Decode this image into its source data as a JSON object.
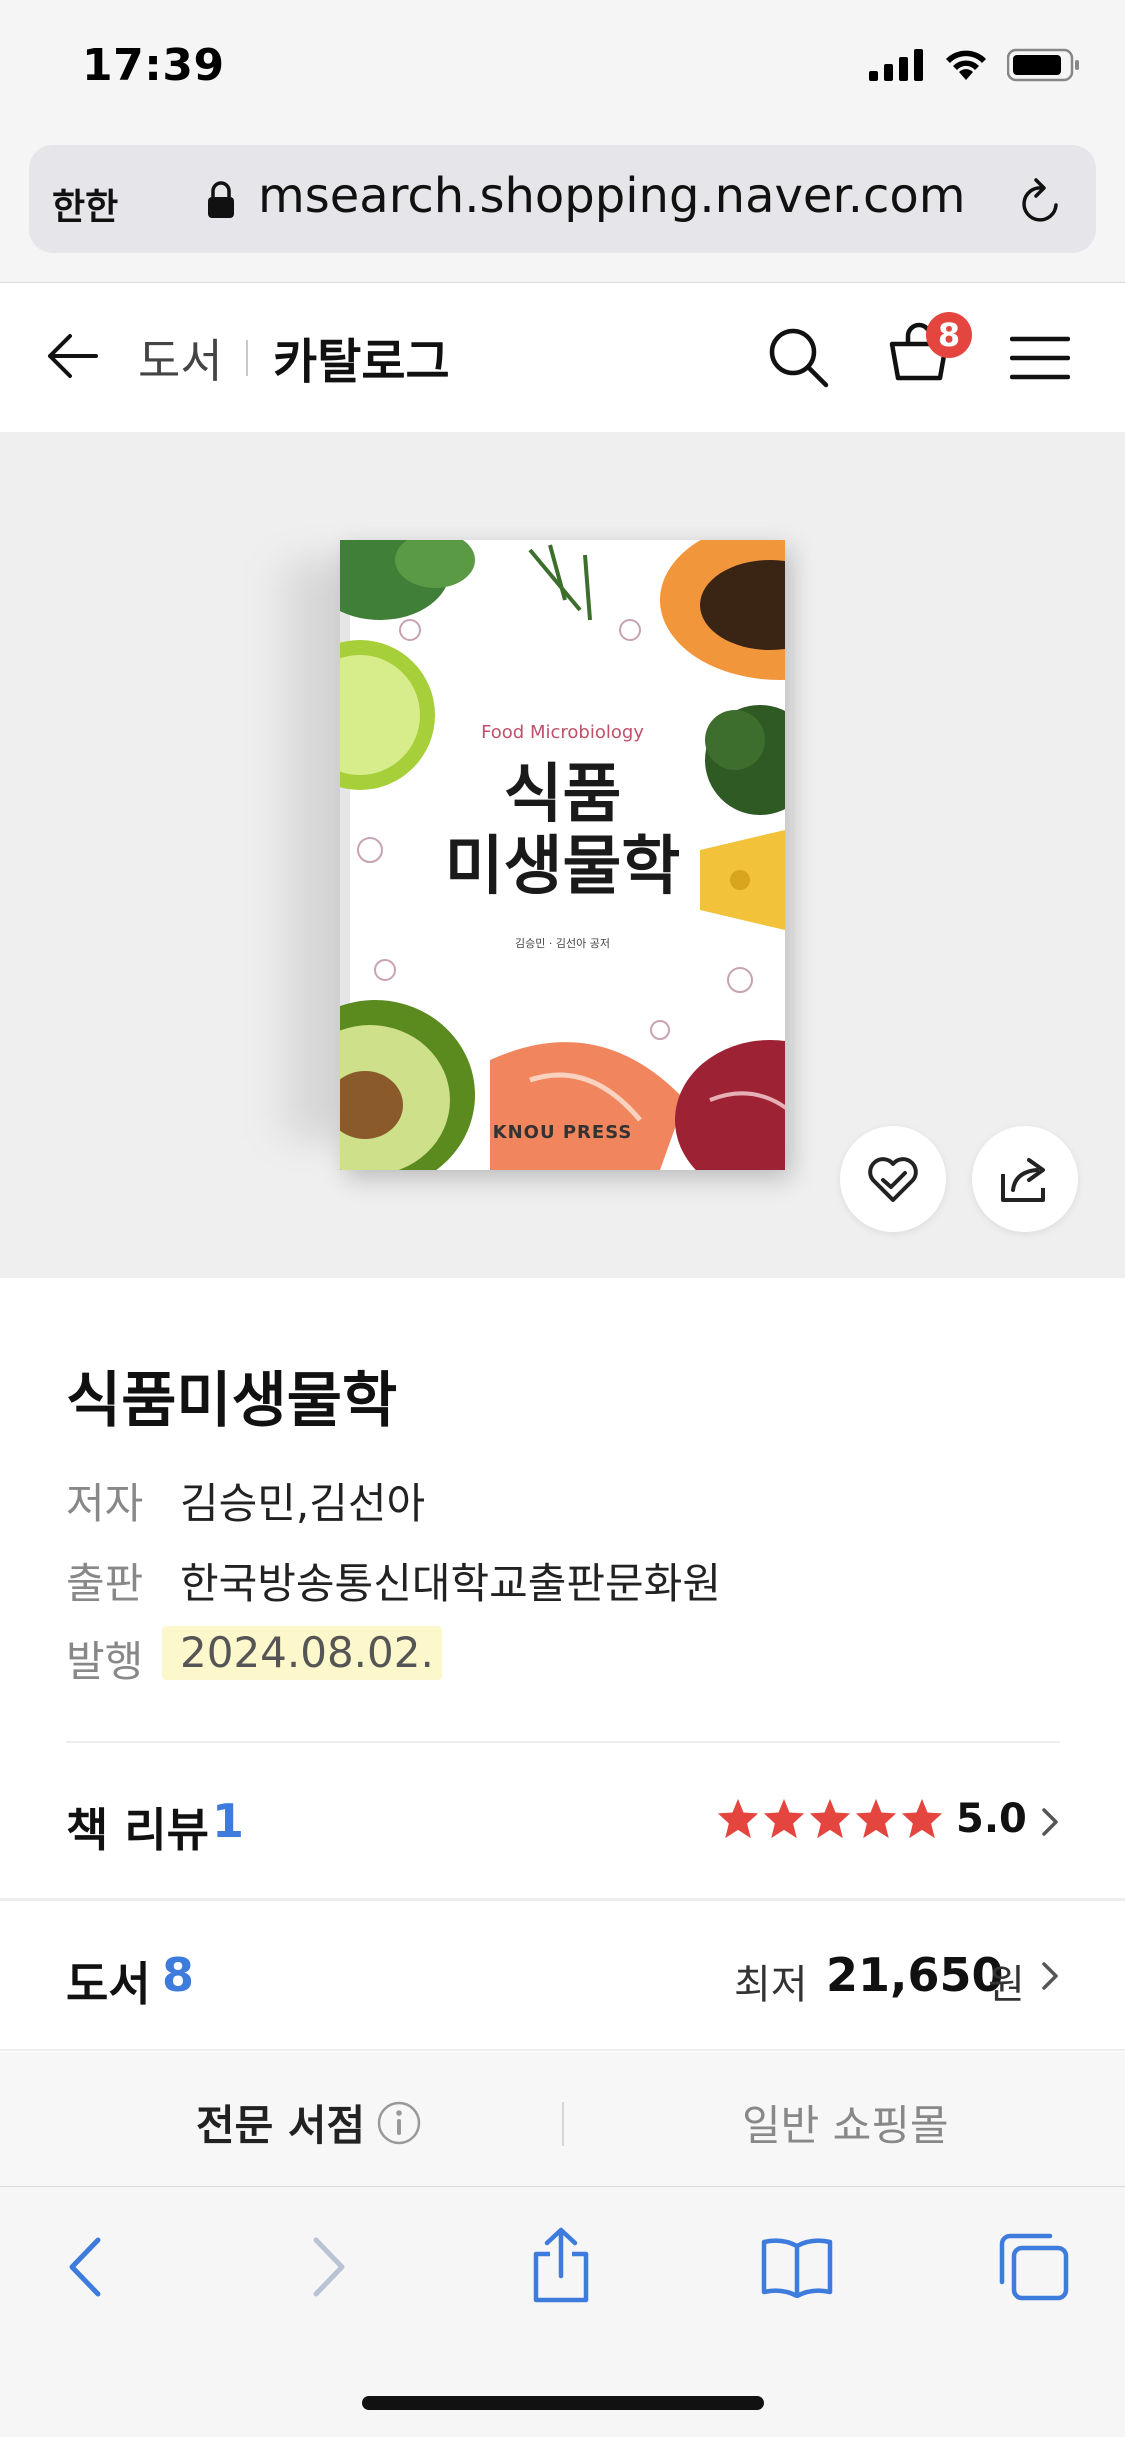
{
  "status_bar": {
    "time": "17:39"
  },
  "browser": {
    "aa_label": "한한",
    "url": "msearch.shopping.naver.com"
  },
  "nav": {
    "breadcrumb_category": "도서",
    "breadcrumb_current": "카탈로그",
    "cart_count": "8"
  },
  "book_cover": {
    "english_title": "Food Microbiology",
    "korean_title_line1": "식품",
    "korean_title_line2": "미생물학",
    "authors_small": "김승민 · 김선아 공저",
    "publisher_logo": "KNOU PRESS"
  },
  "product": {
    "title": "식품미생물학",
    "author_label": "저자",
    "author_value": "김승민,김선아",
    "publisher_label": "출판",
    "publisher_value": "한국방송통신대학교출판문화원",
    "date_label": "발행",
    "date_value": "2024.08.02."
  },
  "reviews": {
    "label": "책 리뷰",
    "count": "1",
    "rating": "5.0",
    "stars": 5
  },
  "books": {
    "label": "도서",
    "count": "8",
    "min_label": "최저",
    "min_price": "21,650",
    "currency": "원"
  },
  "tabs": {
    "tab1": "전문 서점",
    "tab2": "일반 쇼핑몰"
  },
  "colors": {
    "accent_blue": "#3d7bdc",
    "badge_red": "#e5453f",
    "star_red": "#e5453f",
    "date_highlight": "#fdf7cc"
  }
}
